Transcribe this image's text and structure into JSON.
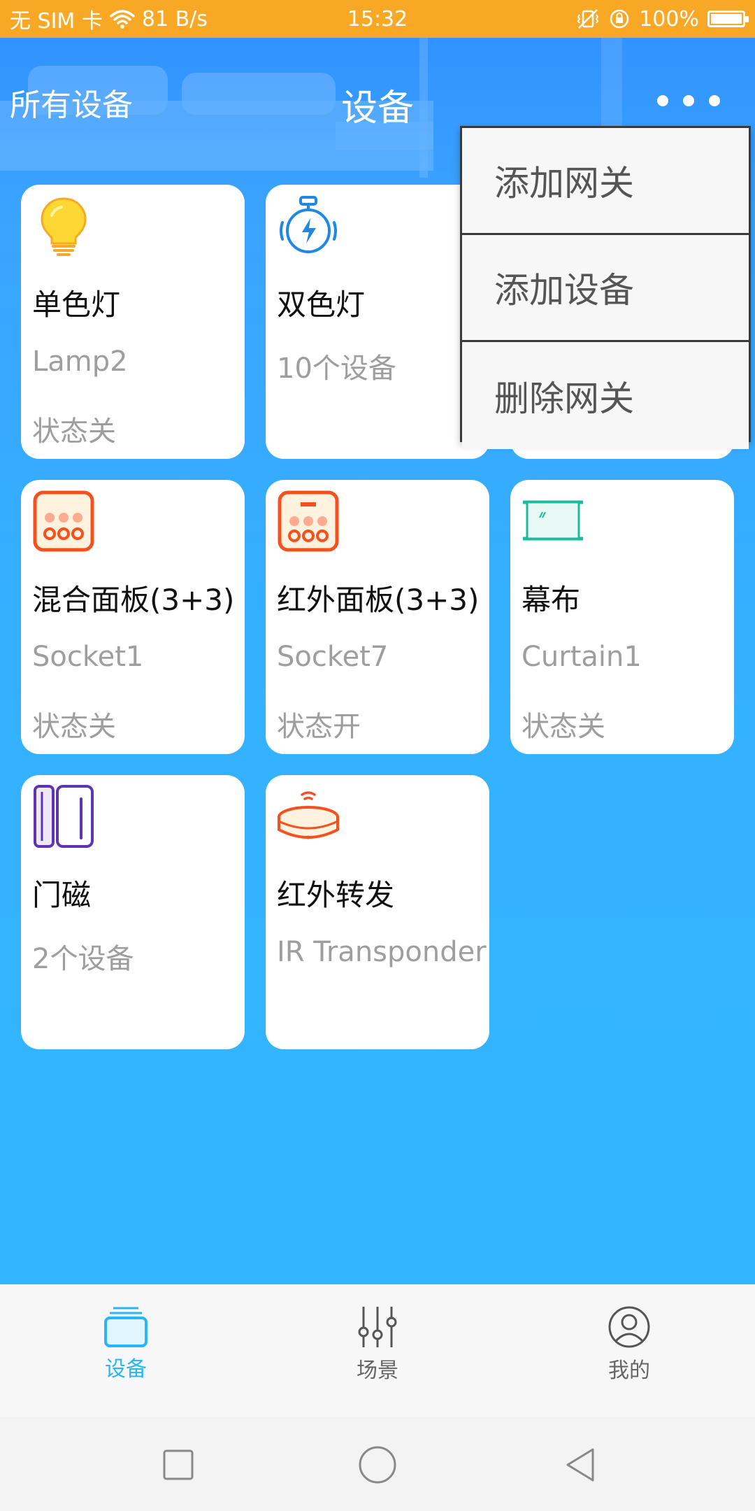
{
  "status_bar": {
    "carrier": "无 SIM 卡",
    "net_speed": "81 B/s",
    "time": "15:32",
    "battery": "100%"
  },
  "header": {
    "left_label": "所有设备",
    "title": "设备",
    "more_icon": "more-dots-icon"
  },
  "menu": {
    "items": [
      {
        "label": "添加网关"
      },
      {
        "label": "添加设备"
      },
      {
        "label": "删除网关"
      }
    ]
  },
  "devices": [
    {
      "name": "单色灯",
      "sub": "Lamp2",
      "state": "状态关",
      "icon": "bulb-icon"
    },
    {
      "name": "双色灯",
      "sub": "10个设备",
      "state": "",
      "icon": "bicolor-lamp-icon"
    },
    {
      "name": "",
      "sub": "",
      "state": "",
      "icon": ""
    },
    {
      "name": "混合面板(3+3)",
      "sub": "Socket1",
      "state": "状态关",
      "icon": "panel-icon"
    },
    {
      "name": "红外面板(3+3)",
      "sub": "Socket7",
      "state": "状态开",
      "icon": "ir-panel-icon"
    },
    {
      "name": "幕布",
      "sub": "Curtain1",
      "state": "状态关",
      "icon": "curtain-screen-icon"
    },
    {
      "name": "门磁",
      "sub": "2个设备",
      "state": "",
      "icon": "door-sensor-icon"
    },
    {
      "name": "红外转发",
      "sub": "IR Transponder",
      "state": "",
      "icon": "ir-transponder-icon"
    }
  ],
  "bottom_nav": {
    "items": [
      {
        "label": "设备",
        "icon": "device-tab-icon",
        "active": true
      },
      {
        "label": "场景",
        "icon": "scene-sliders-icon",
        "active": false
      },
      {
        "label": "我的",
        "icon": "profile-icon",
        "active": false
      }
    ]
  },
  "colors": {
    "status_bar": "#f9a825",
    "accent": "#29b6f6",
    "background_top": "#2f8fff",
    "background_bottom": "#33b6ff"
  }
}
